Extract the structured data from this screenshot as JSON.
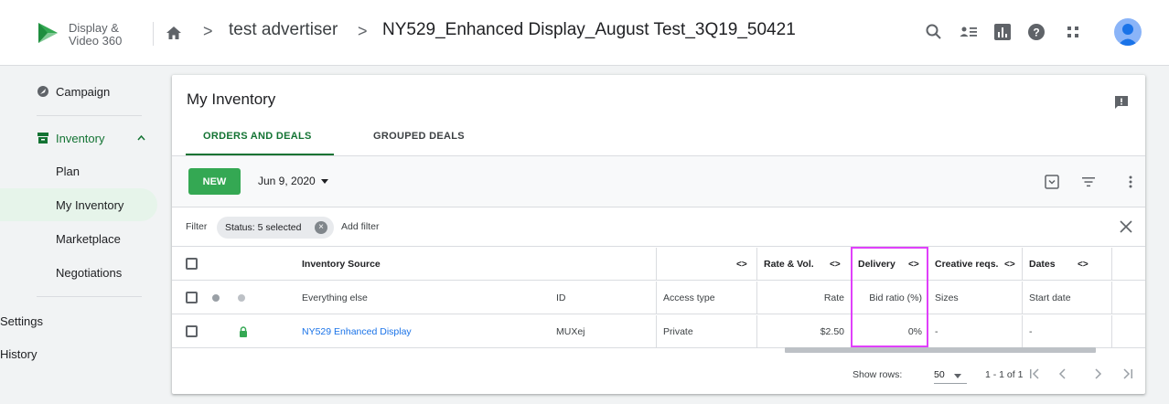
{
  "app": {
    "name_line1": "Display &",
    "name_line2": "Video 360"
  },
  "breadcrumb": {
    "advertiser": "test advertiser",
    "campaign": "NY529_Enhanced Display_August Test_3Q19_50421",
    "separator": ">"
  },
  "header_icons": [
    "search-icon",
    "account-switch-icon",
    "reports-icon",
    "help-icon",
    "apps-grid-icon",
    "avatar"
  ],
  "sidebar": {
    "campaign": "Campaign",
    "inventory": "Inventory",
    "items": [
      {
        "label": "Plan"
      },
      {
        "label": "My Inventory"
      },
      {
        "label": "Marketplace"
      },
      {
        "label": "Negotiations"
      }
    ],
    "settings": "Settings",
    "history": "History"
  },
  "page": {
    "title": "My Inventory",
    "tabs": [
      {
        "label": "ORDERS AND DEALS"
      },
      {
        "label": "GROUPED DEALS"
      }
    ]
  },
  "toolbar": {
    "new_label": "NEW",
    "date": "Jun 9, 2020"
  },
  "filter": {
    "label": "Filter",
    "chip": "Status: 5 selected",
    "add": "Add filter"
  },
  "table": {
    "group_headers": {
      "inventory_source": "Inventory Source",
      "arrows": "<>",
      "rate_vol": "Rate & Vol.",
      "delivery": "Delivery",
      "creative": "Creative reqs.",
      "dates": "Dates"
    },
    "columns": {
      "name": "Everything else",
      "id": "ID",
      "access": "Access type",
      "rate": "Rate",
      "bid_ratio": "Bid ratio (%)",
      "sizes": "Sizes",
      "start": "Start date"
    },
    "rows": [
      {
        "name": "NY529 Enhanced Display",
        "id": "MUXej",
        "access": "Private",
        "rate": "$2.50",
        "bid_ratio": "0%",
        "sizes": "-",
        "start": "-"
      }
    ]
  },
  "footer": {
    "show_rows": "Show rows:",
    "rows_value": "50",
    "range": "1 - 1 of 1"
  },
  "colors": {
    "accent_green": "#137333",
    "button_green": "#34a853",
    "link_blue": "#1a73e8",
    "highlight": "#e040fb"
  }
}
